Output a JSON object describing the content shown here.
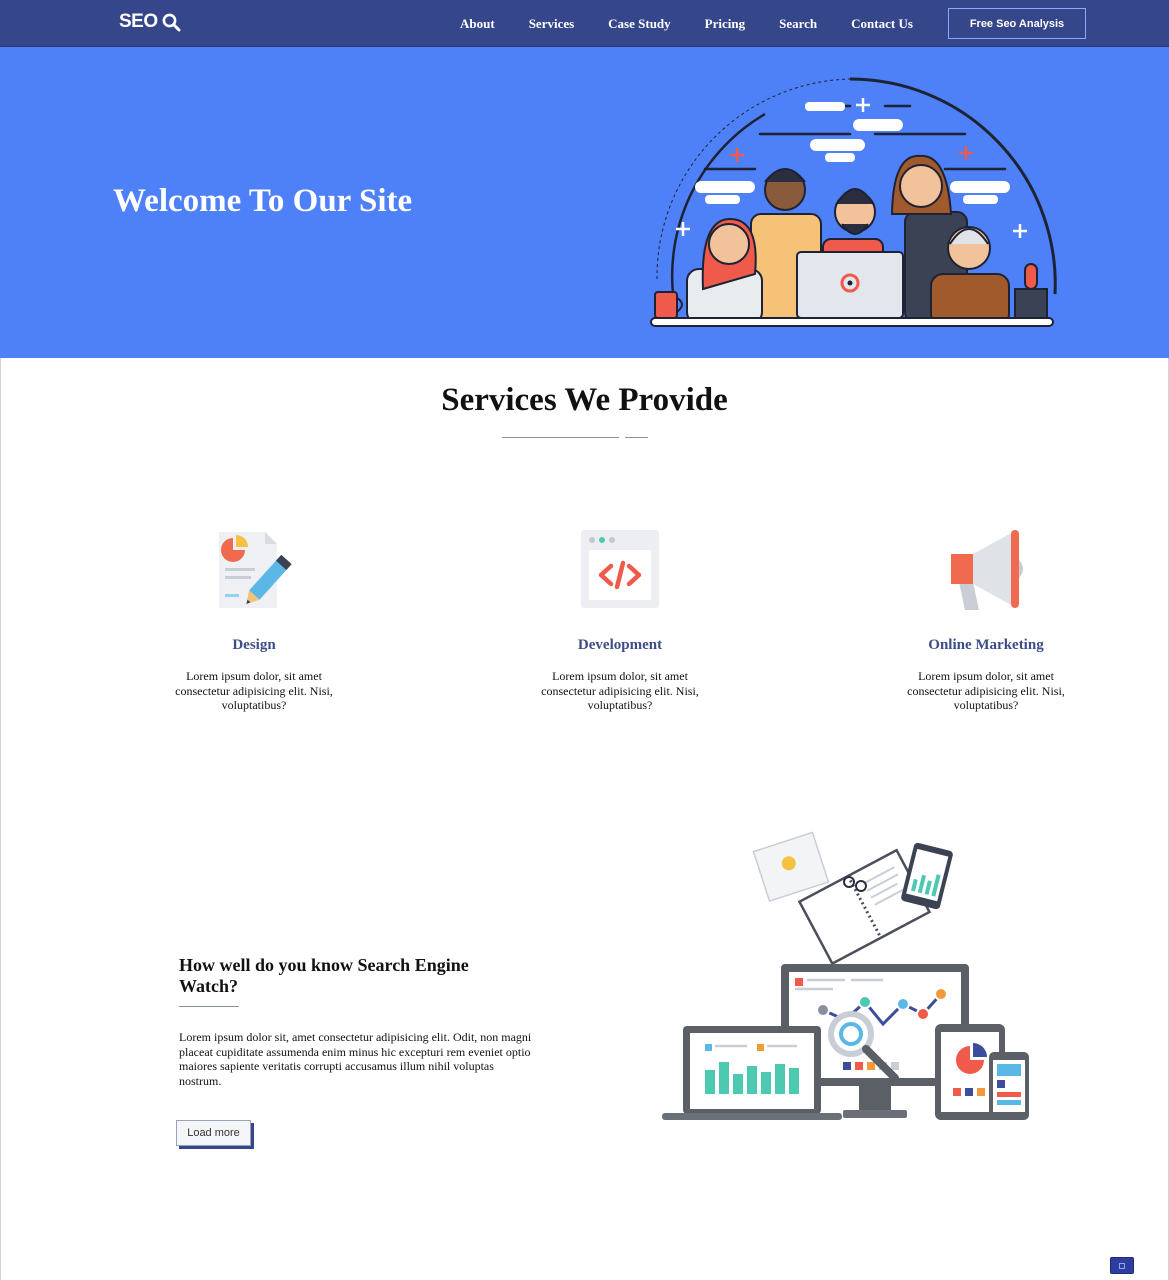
{
  "nav": {
    "logo_text": "SEO",
    "logo_icon": "search-icon",
    "links": [
      "About",
      "Services",
      "Case Study",
      "Pricing",
      "Search",
      "Contact Us"
    ],
    "cta_label": "Free Seo Analysis"
  },
  "hero": {
    "title": "Welcome To Our Site",
    "illustration": "team-illustration"
  },
  "services": {
    "title": "Services We Provide",
    "items": [
      {
        "icon": "design-document-icon",
        "title": "Design",
        "text": "Lorem ipsum dolor, sit amet consectetur adipisicing elit. Nisi, voluptatibus?"
      },
      {
        "icon": "code-window-icon",
        "title": "Development",
        "text": "Lorem ipsum dolor, sit amet consectetur adipisicing elit. Nisi, voluptatibus?"
      },
      {
        "icon": "megaphone-icon",
        "title": "Online Marketing",
        "text": "Lorem ipsum dolor, sit amet consectetur adipisicing elit. Nisi, voluptatibus?"
      }
    ]
  },
  "feature": {
    "title": "How well do you know Search Engine Watch?",
    "text": "Lorem ipsum dolor sit, amet consectetur adipisicing elit. Odit, non magni placeat cupiditate assumenda enim minus hic excepturi rem eveniet optio maiores sapiente veritatis corrupti accusamus illum nihil voluptas nostrum.",
    "button_label": "Load more",
    "illustration": "devices-analytics-illustration"
  },
  "colors": {
    "navbar": "#35468a",
    "hero": "#4e80f7",
    "accent": "#3d4d8a"
  }
}
